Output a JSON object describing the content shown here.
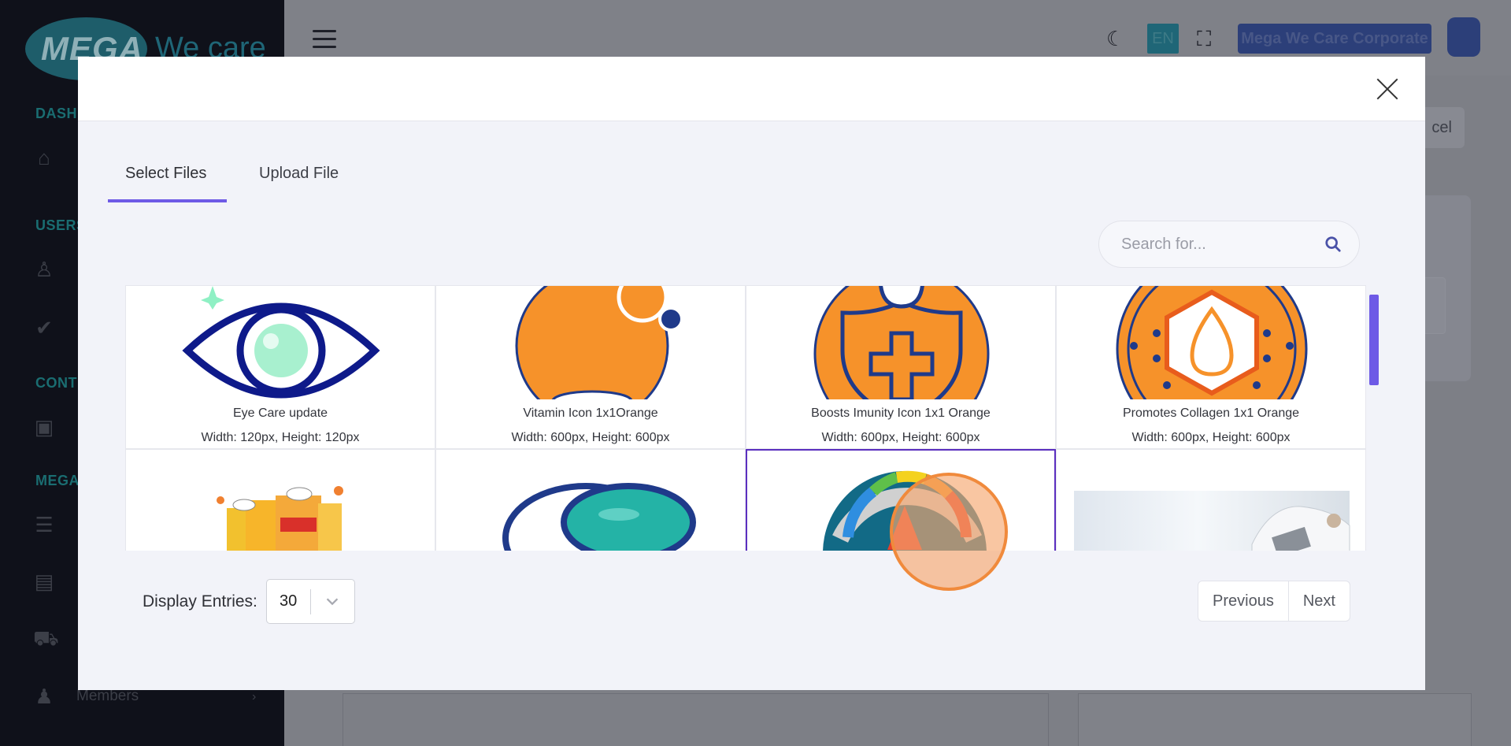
{
  "background": {
    "logo_primary": "MEGA",
    "logo_secondary": "We care",
    "sidebar_sections": [
      "DASH",
      "USERS",
      "CONT",
      "MEGA"
    ],
    "sidebar_item_members": "Members",
    "language": "EN",
    "corporate_label": "Mega We Care Corporate",
    "cancel_label": "cel"
  },
  "modal": {
    "tabs": [
      {
        "label": "Select Files",
        "active": true
      },
      {
        "label": "Upload File",
        "active": false
      }
    ],
    "search": {
      "placeholder": "Search for...",
      "value": ""
    },
    "files": [
      {
        "name": "Eye Care update",
        "dimensions": "Width: 120px, Height: 120px",
        "icon": "eye-icon"
      },
      {
        "name": "Vitamin Icon 1x1Orange",
        "dimensions": "Width: 600px, Height: 600px",
        "icon": "vitamin-icon"
      },
      {
        "name": "Boosts Imunity Icon 1x1 Orange",
        "dimensions": "Width: 600px, Height: 600px",
        "icon": "immunity-shield-icon"
      },
      {
        "name": "Promotes Collagen 1x1 Orange",
        "dimensions": "Width: 600px, Height: 600px",
        "icon": "collagen-drop-icon"
      },
      {
        "name": "",
        "dimensions": "",
        "icon": "nat-c-product-image"
      },
      {
        "name": "",
        "dimensions": "",
        "icon": "capsule-icon"
      },
      {
        "name": "",
        "dimensions": "",
        "icon": "gauge-icon",
        "selected": true
      },
      {
        "name": "",
        "dimensions": "",
        "icon": "doctor-photo"
      }
    ],
    "display_entries_label": "Display Entries:",
    "display_entries_value": "30",
    "pagination": {
      "previous": "Previous",
      "next": "Next"
    }
  },
  "colors": {
    "accent": "#6e5ae6",
    "selected_border": "#5b2fbf",
    "icon_orange": "#f6922a",
    "icon_navy": "#1f3a8a"
  }
}
